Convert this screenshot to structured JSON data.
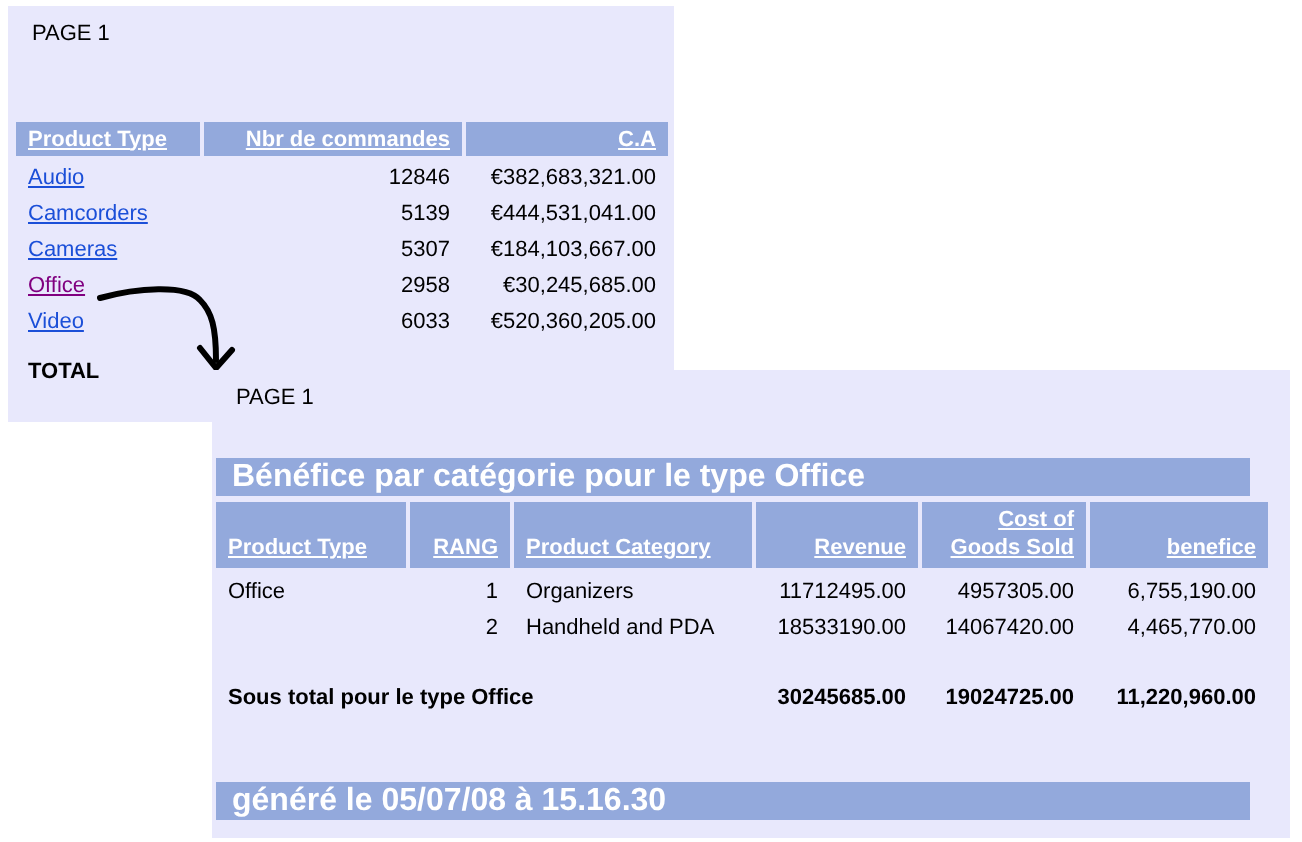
{
  "main_report": {
    "page_label": "PAGE 1",
    "columns": [
      "Product Type",
      "Nbr de commandes",
      "C.A"
    ],
    "rows": [
      {
        "product_type": "Audio",
        "visited": false,
        "orders": "12846",
        "ca": "€382,683,321.00"
      },
      {
        "product_type": "Camcorders",
        "visited": false,
        "orders": "5139",
        "ca": "€444,531,041.00"
      },
      {
        "product_type": "Cameras",
        "visited": false,
        "orders": "5307",
        "ca": "€184,103,667.00"
      },
      {
        "product_type": "Office",
        "visited": true,
        "orders": "2958",
        "ca": "€30,245,685.00"
      },
      {
        "product_type": "Video",
        "visited": false,
        "orders": "6033",
        "ca": "€520,360,205.00"
      }
    ],
    "total_label": "TOTAL"
  },
  "detail_report": {
    "page_label": "PAGE 1",
    "title": "Bénéfice par catégorie pour le type Office",
    "columns": [
      "Product Type",
      "RANG",
      "Product Category",
      "Revenue",
      "Cost of Goods Sold",
      "benefice"
    ],
    "rows": [
      {
        "product_type": "Office",
        "rang": "1",
        "category": "Organizers",
        "revenue": "11712495.00",
        "cost": "4957305.00",
        "benefice": "6,755,190.00"
      },
      {
        "rang": "2",
        "category": "Handheld and PDA",
        "revenue": "18533190.00",
        "cost": "14067420.00",
        "benefice": "4,465,770.00"
      }
    ],
    "subtotal": {
      "label": "Sous total pour le type Office",
      "revenue": "30245685.00",
      "cost": "19024725.00",
      "benefice": "11,220,960.00"
    },
    "footer": "généré le 05/07/08 à 15.16.30"
  }
}
